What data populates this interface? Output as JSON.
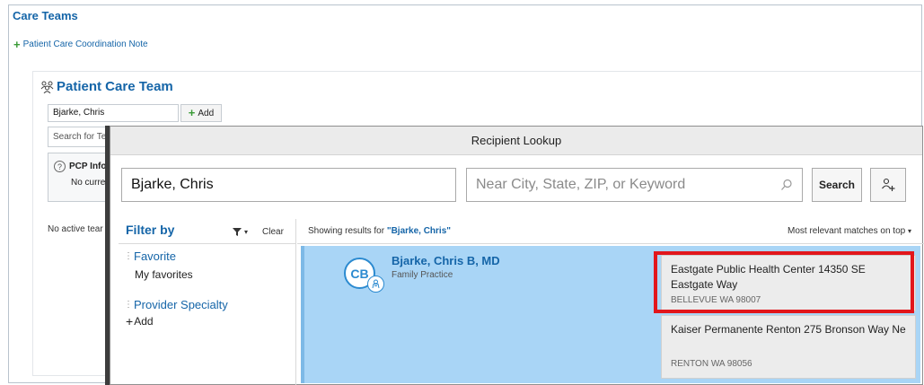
{
  "care_teams": {
    "title": "Care Teams",
    "coordination_note_link": "Patient Care Coordination Note"
  },
  "patient_care_team": {
    "title": "Patient Care Team",
    "member_input_value": "Bjarke, Chris",
    "add_label": "Add",
    "search_placeholder_visible": "Search for Te",
    "pcp_info_label": "PCP Info",
    "pcp_info_value": "No curre",
    "no_active_text": "No active tear"
  },
  "recipient_lookup": {
    "title": "Recipient Lookup",
    "name_input_value": "Bjarke, Chris",
    "location_placeholder": "Near City, State, ZIP, or Keyword",
    "search_button_label": "Search",
    "filter": {
      "title": "Filter by",
      "clear_label": "Clear",
      "favorite_section": "Favorite",
      "favorite_item": "My favorites",
      "specialty_section": "Provider Specialty",
      "specialty_add": "Add"
    },
    "results": {
      "showing_prefix": "Showing results for ",
      "showing_query": "\"Bjarke, Chris\"",
      "sort_label": "Most relevant matches on top",
      "items": [
        {
          "initials": "CB",
          "name": "Bjarke, Chris B, MD",
          "specialty": "Family Practice",
          "locations": [
            {
              "name": "Eastgate Public Health Center 14350 SE Eastgate Way",
              "city": "BELLEVUE WA 98007"
            },
            {
              "name": "Kaiser Permanente Renton 275 Bronson Way Ne",
              "city": "RENTON WA 98056"
            }
          ]
        }
      ]
    }
  },
  "colors": {
    "accent_blue": "#1565a8",
    "selected_row": "#a9d5f6",
    "highlight_red": "#e2161b",
    "add_green": "#3a9b37"
  }
}
